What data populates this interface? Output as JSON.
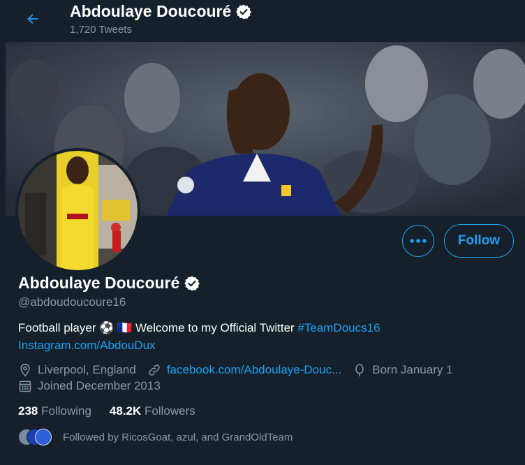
{
  "header": {
    "name": "Abdoulaye Doucouré",
    "tweet_count": "1,720 Tweets"
  },
  "profile": {
    "name": "Abdoulaye Doucouré",
    "handle": "@abdoudoucoure16",
    "bio_text": "Football player ⚽ 🇫🇷 Welcome to my Official Twitter ",
    "bio_hashtag": "#TeamDoucs16",
    "bio_link": "Instagram.com/AbdouDux",
    "location": "Liverpool, England",
    "website": "facebook.com/Abdoulaye-Douc...",
    "birthday": "Born January 1",
    "joined": "Joined December 2013",
    "following_count": "238",
    "following_label": "Following",
    "followers_count": "48.2K",
    "followers_label": "Followers",
    "followed_by": "Followed by RicosGoat, azul, and GrandOldTeam"
  },
  "actions": {
    "follow_label": "Follow"
  },
  "colors": {
    "background": "#15202b",
    "accent": "#1da1f2",
    "secondary_text": "#8899a6"
  }
}
